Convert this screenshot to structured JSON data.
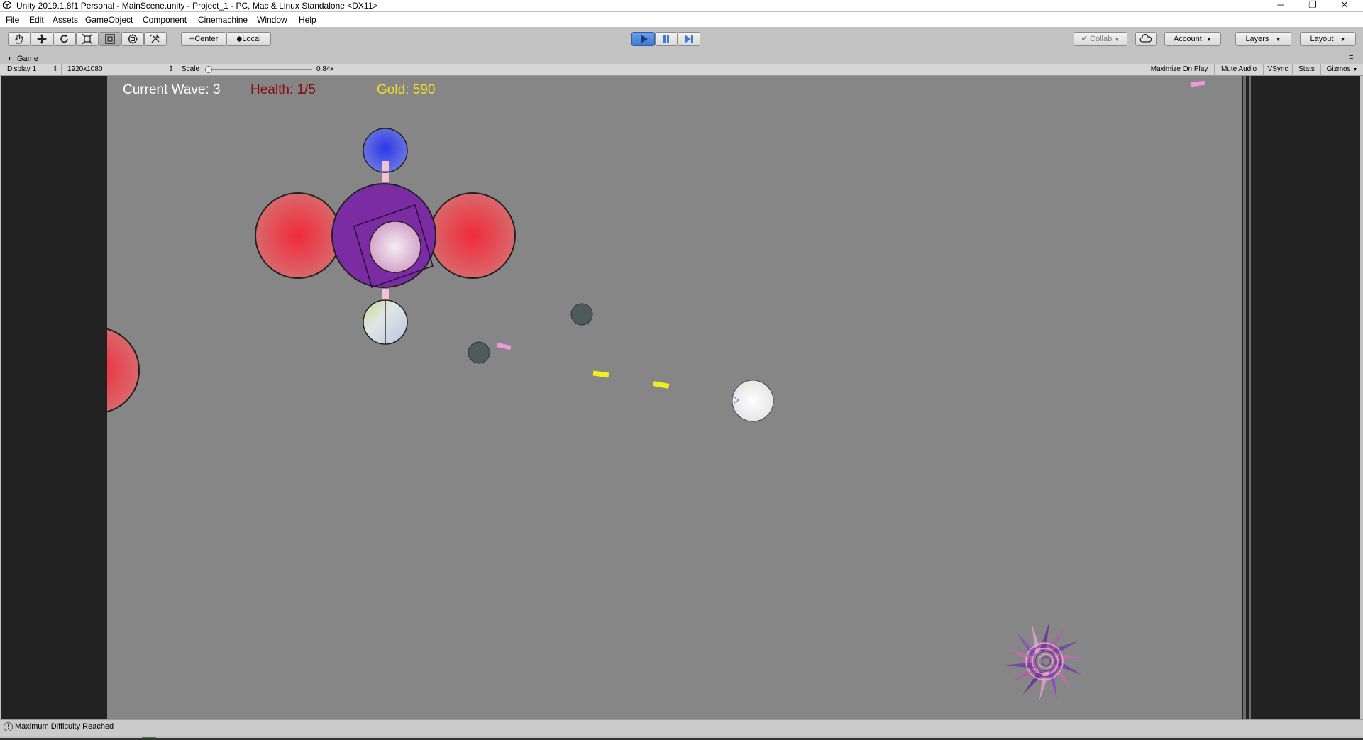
{
  "window": {
    "title": "Unity 2019.1.8f1 Personal - MainScene.unity - Project_1 - PC, Mac & Linux Standalone <DX11>",
    "controls": [
      "─",
      "❐",
      "✕"
    ]
  },
  "menu": [
    "File",
    "Edit",
    "Assets",
    "GameObject",
    "Component",
    "Cinemachine",
    "Window",
    "Help"
  ],
  "toolbar": {
    "tools": [
      "hand-icon",
      "move-icon",
      "rotate-icon",
      "scale-icon",
      "rect-icon",
      "transform-icon",
      "custom-tool-icon"
    ],
    "pivot_label": "Center",
    "space_label": "Local",
    "collab_label": "Collab",
    "account_label": "Account",
    "layers_label": "Layers",
    "layout_label": "Layout",
    "play_state": "playing",
    "accent": "#3c7ad6"
  },
  "game_tab": {
    "title": "Game",
    "display": "Display 1",
    "resolution": "1920x1080",
    "scale_label": "Scale",
    "scale_value": "0.84x",
    "scale_fraction": 0.02,
    "buttons": [
      "Maximize On Play",
      "Mute Audio",
      "VSync",
      "Stats",
      "Gizmos"
    ]
  },
  "hud": {
    "wave": "Current Wave: 3",
    "health": "Health: 1/5",
    "gold": "Gold: 590",
    "wave_color": "#ffffff",
    "health_color": "#8a0c0c",
    "gold_color": "#f0e020"
  },
  "status": {
    "message": "Maximum Difficulty Reached"
  }
}
